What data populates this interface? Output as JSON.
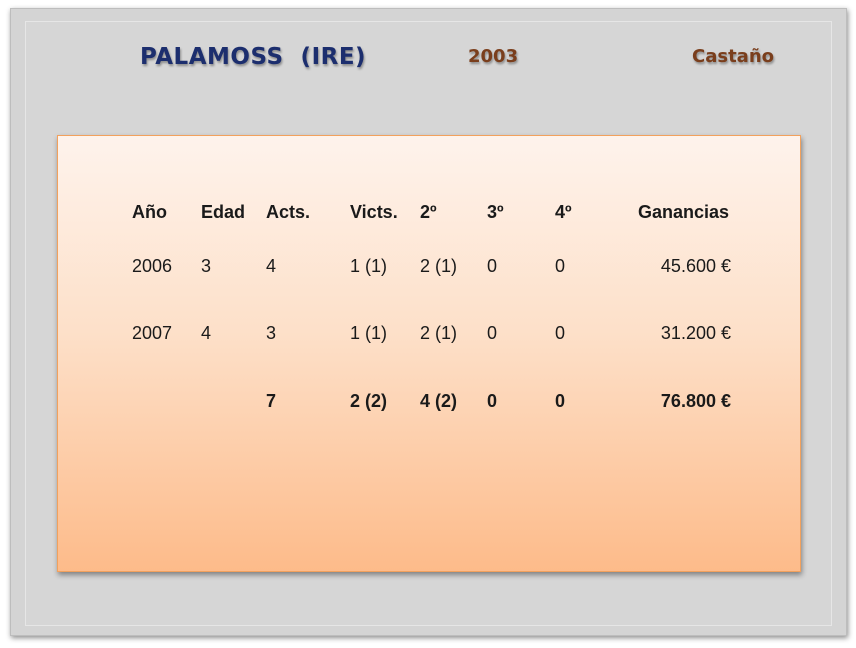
{
  "header": {
    "horse_name": "PALAMOSS  (IRE)",
    "birth_year": "2003",
    "coat_color": "Castaño"
  },
  "table": {
    "columns": [
      "Año",
      "Edad",
      "Acts.",
      "Victs.",
      "2º",
      "3º",
      "4º",
      "Ganancias"
    ],
    "rows": [
      [
        "2006",
        "3",
        "4",
        "1 (1)",
        "2 (1)",
        "0",
        "0",
        "45.600 €"
      ],
      [
        "2007",
        "4",
        "3",
        "1 (1)",
        "2 (1)",
        "0",
        "0",
        "31.200 €"
      ]
    ],
    "totals": [
      "",
      "",
      "7",
      "2 (2)",
      "4 (2)",
      "0",
      "0",
      "76.800 €"
    ]
  }
}
